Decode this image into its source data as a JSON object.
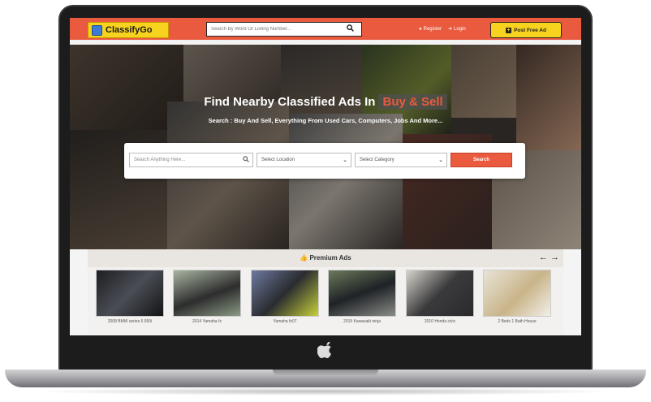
{
  "header": {
    "logo_text": "ClassifyGo",
    "search_placeholder": "Search By Word Or Listing Number...",
    "register_label": "Register",
    "login_label": "Login",
    "post_ad_label": "Post Free Ad"
  },
  "hero": {
    "title": "Find Nearby Classified Ads In",
    "title_highlight": "Buy & Sell",
    "subtitle": "Search : Buy And Sell, Everything From Used Cars, Computers, Jobs And More...",
    "search_placeholder": "Search Anything Here...",
    "location_select": "Select Location",
    "category_select": "Select Category",
    "search_button": "Search"
  },
  "premium": {
    "title": "Premium Ads",
    "ads": [
      {
        "label": "2008 BMW series 6 650i"
      },
      {
        "label": "2014 Yamaha fz"
      },
      {
        "label": "Yamaha fz07"
      },
      {
        "label": "2019 Kawasaki ninja"
      },
      {
        "label": "2010 Honda civic"
      },
      {
        "label": "2 Beds 1 Bath House"
      }
    ]
  },
  "colors": {
    "accent": "#ea5a3f",
    "brand_yellow": "#f7d21e"
  },
  "icons": {
    "search": "search-icon",
    "user": "user-icon",
    "login": "login-icon",
    "plus": "plus-icon",
    "thumbs_up": "thumbs-up-icon",
    "arrow_left": "arrow-left-icon",
    "arrow_right": "arrow-right-icon",
    "apple": "apple-logo-icon"
  }
}
